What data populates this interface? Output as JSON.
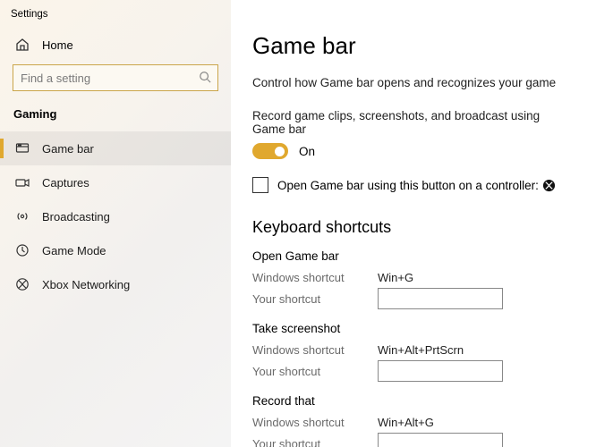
{
  "window_title": "Settings",
  "home_label": "Home",
  "search": {
    "placeholder": "Find a setting"
  },
  "category": "Gaming",
  "nav": [
    {
      "id": "gamebar",
      "label": "Game bar",
      "selected": true
    },
    {
      "id": "captures",
      "label": "Captures",
      "selected": false
    },
    {
      "id": "broadcasting",
      "label": "Broadcasting",
      "selected": false
    },
    {
      "id": "gamemode",
      "label": "Game Mode",
      "selected": false
    },
    {
      "id": "xbox",
      "label": "Xbox Networking",
      "selected": false
    }
  ],
  "main": {
    "title": "Game bar",
    "description": "Control how Game bar opens and recognizes your game",
    "record_label": "Record game clips, screenshots, and broadcast using Game bar",
    "toggle_state": "On",
    "controller_label": "Open Game bar using this button on a controller:",
    "shortcuts_heading": "Keyboard shortcuts",
    "windows_shortcut_label": "Windows shortcut",
    "your_shortcut_label": "Your shortcut",
    "shortcuts": [
      {
        "name": "Open Game bar",
        "win": "Win+G",
        "user": ""
      },
      {
        "name": "Take screenshot",
        "win": "Win+Alt+PrtScrn",
        "user": ""
      },
      {
        "name": "Record that",
        "win": "Win+Alt+G",
        "user": ""
      }
    ]
  }
}
